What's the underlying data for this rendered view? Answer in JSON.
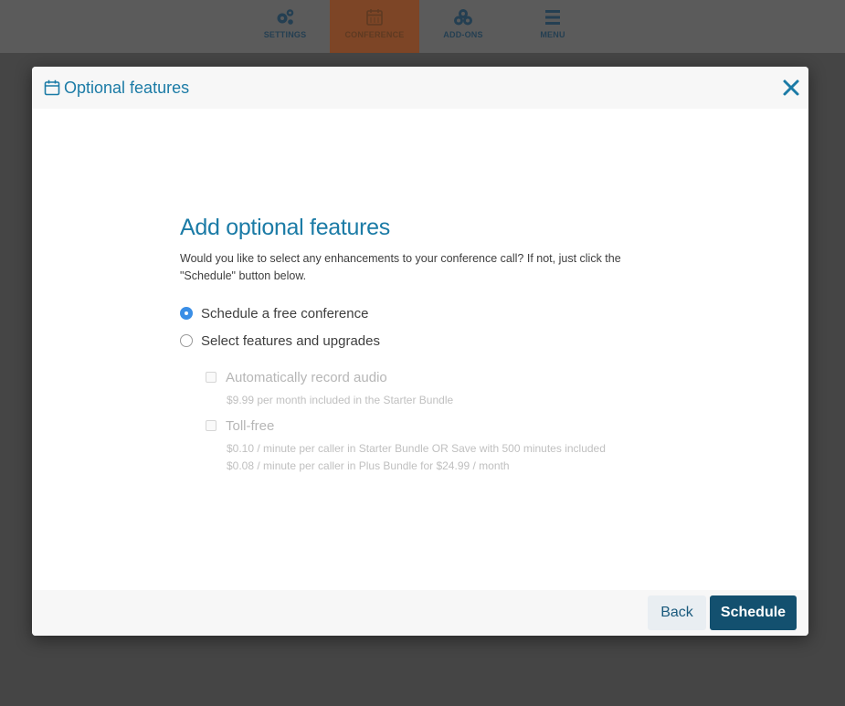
{
  "nav": {
    "items": [
      {
        "label": "SETTINGS",
        "icon": "gears-icon",
        "active": false
      },
      {
        "label": "CONFERENCE",
        "icon": "calendar-icon",
        "active": true
      },
      {
        "label": "ADD-ONS",
        "icon": "cubes-icon",
        "active": false
      },
      {
        "label": "MENU",
        "icon": "hamburger-icon",
        "active": false
      }
    ]
  },
  "modal": {
    "title": "Optional features",
    "title_icon": "calendar-icon",
    "close_icon": "close-icon",
    "heading": "Add optional features",
    "intro_line1": "Would you like to select any enhancements to your conference call? If not, just click the",
    "intro_line2": "\"Schedule\" button below.",
    "options": [
      {
        "label": "Schedule a free conference",
        "checked": true
      },
      {
        "label": "Select features and upgrades",
        "checked": false
      }
    ],
    "features": [
      {
        "label": "Automatically record audio",
        "checked": false,
        "disabled": true,
        "notes": [
          "$9.99 per month included in the Starter Bundle"
        ]
      },
      {
        "label": "Toll-free",
        "checked": false,
        "disabled": true,
        "notes": [
          "$0.10 / minute per caller in Starter Bundle OR Save with 500 minutes included",
          "$0.08 / minute per caller in Plus Bundle for $24.99 / month"
        ]
      }
    ],
    "back_label": "Back",
    "schedule_label": "Schedule"
  },
  "colors": {
    "accent": "#1b7ba6",
    "primary_button": "#13506f",
    "active_tab": "#7d4526",
    "radio_checked": "#3a8ee6",
    "backdrop": "#454545"
  }
}
